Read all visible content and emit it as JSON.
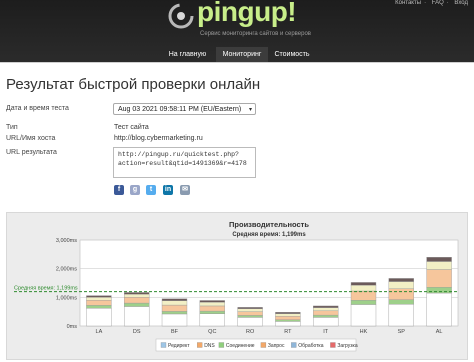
{
  "header": {
    "toplinks": [
      "Контакты",
      "FAQ",
      "Вход"
    ],
    "logo_text": "pingup!",
    "tagline": "Сервис мониторинга сайтов и серверов",
    "nav": [
      "На главную",
      "Мониторинг",
      "Стоимость"
    ],
    "active_nav": "Мониторинг"
  },
  "page": {
    "title": "Результат быстрой проверки онлайн",
    "date_label": "Дата и время теста",
    "date_value": "Aug 03 2021 09:58:11 PM (EU/Eastern)",
    "type_label": "Тип",
    "type_value": "Тест сайта",
    "host_label": "URL/Имя хоста",
    "host_value": "http://blog.cybermarketing.ru",
    "result_label": "URL результата",
    "result_url": "http://pingup.ru/quicktest.php?\naction=result&qtid=1491369&r=4178",
    "share_icons": [
      "facebook-icon",
      "google-bookmarks-icon",
      "twitter-icon",
      "linkedin-icon",
      "email-icon"
    ]
  },
  "chart_data": {
    "type": "bar",
    "title": "Производительность",
    "subtitle": "Средняя время: 1,199ms",
    "avg_label": "Средняя время: 1,199ms",
    "average": 1199,
    "ylim": [
      0,
      3000
    ],
    "yticks": [
      "0ms",
      "1,000ms",
      "2,000ms",
      "3,000ms"
    ],
    "categories": [
      "LA",
      "DS",
      "BF",
      "QC",
      "RO",
      "RT",
      "IT",
      "HK",
      "SP",
      "AL"
    ],
    "series": [
      {
        "name": "Редирект",
        "color": "#d7e7f7",
        "values": [
          0,
          0,
          0,
          0,
          0,
          0,
          0,
          0,
          0,
          0
        ]
      },
      {
        "name": "DNS",
        "color": "#ffffff",
        "values": [
          620,
          680,
          420,
          430,
          300,
          160,
          300,
          750,
          760,
          1150
        ]
      },
      {
        "name": "Соединение",
        "color": "#9ed08a",
        "values": [
          100,
          120,
          90,
          90,
          70,
          60,
          80,
          150,
          160,
          200
        ]
      },
      {
        "name": "Запрос",
        "color": "#f6c69c",
        "values": [
          180,
          200,
          220,
          180,
          130,
          120,
          150,
          320,
          380,
          620
        ]
      },
      {
        "name": "Обработка",
        "color": "#f2efc5",
        "values": [
          100,
          110,
          150,
          130,
          100,
          90,
          110,
          200,
          250,
          280
        ]
      },
      {
        "name": "Загрузка",
        "color": "#6b5a5a",
        "values": [
          60,
          60,
          70,
          60,
          50,
          50,
          60,
          100,
          110,
          150
        ]
      }
    ],
    "legend_colors": [
      "#9ec6e6",
      "#f3a868",
      "#8fcf7c",
      "#f3a868",
      "#8fb6d9",
      "#e56a6a"
    ]
  }
}
